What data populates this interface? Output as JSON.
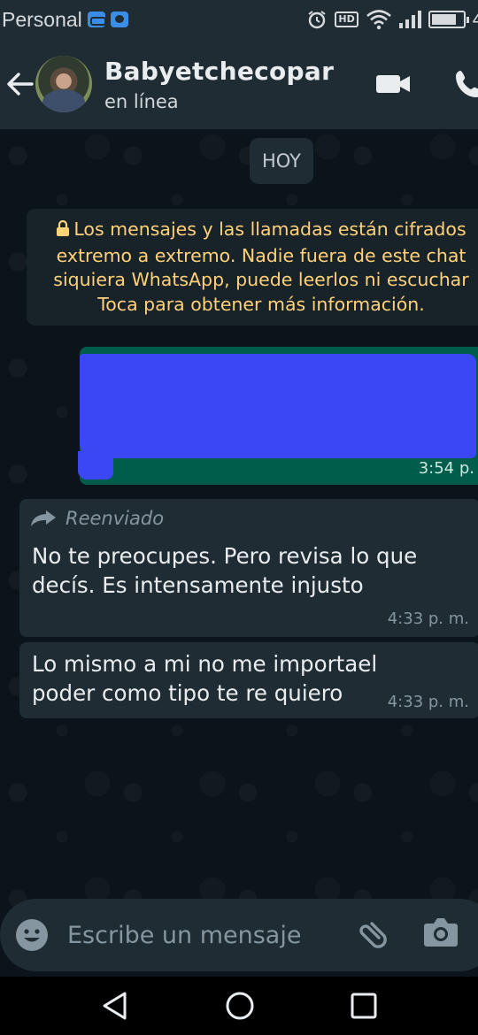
{
  "status_bar": {
    "carrier": "Personal",
    "battery_partial": "4",
    "icons": [
      "voicemail-icon",
      "message-icon",
      "alarm-icon",
      "hd-icon",
      "wifi-icon",
      "signal-icon",
      "battery-icon"
    ],
    "hd_label": "HD"
  },
  "header": {
    "contact_name": "Babyetchecopar",
    "contact_status": "en línea",
    "back_icon": "back-arrow-icon",
    "video_icon": "video-call-icon",
    "call_icon": "phone-icon"
  },
  "chat": {
    "date_chip": "HOY",
    "encryption_notice": {
      "lines": [
        "Los mensajes y las llamadas están cifrados",
        "extremo a extremo. Nadie fuera de este chat",
        "siquiera WhatsApp, puede leerlos ni escuchar",
        "Toca para obtener más información."
      ]
    },
    "messages": [
      {
        "direction": "outgoing",
        "redacted": true,
        "time": "3:54 p."
      },
      {
        "direction": "incoming",
        "forwarded_label": "Reenviado",
        "lines": [
          "No te preocupes. Pero revisa lo que",
          "decís. Es intensamente injusto"
        ],
        "time": "4:33 p. m."
      },
      {
        "direction": "incoming",
        "lines": [
          "Lo mismo a mi no me importael",
          "poder como tipo te re quiero"
        ],
        "time": "4:33 p. m."
      }
    ]
  },
  "composer": {
    "placeholder": "Escribe un mensaje",
    "emoji_icon": "emoji-icon",
    "attach_icon": "paperclip-icon",
    "camera_icon": "camera-icon"
  },
  "nav": {
    "back": "nav-back-icon",
    "home": "nav-home-icon",
    "recents": "nav-recents-icon"
  },
  "colors": {
    "header_bg": "#1f2c33",
    "chat_bg": "#0b141a",
    "outgoing_bubble": "#005c4b",
    "incoming_bubble": "#1f2c33",
    "notice_text": "#ffd279",
    "redaction": "#3b47f5"
  }
}
